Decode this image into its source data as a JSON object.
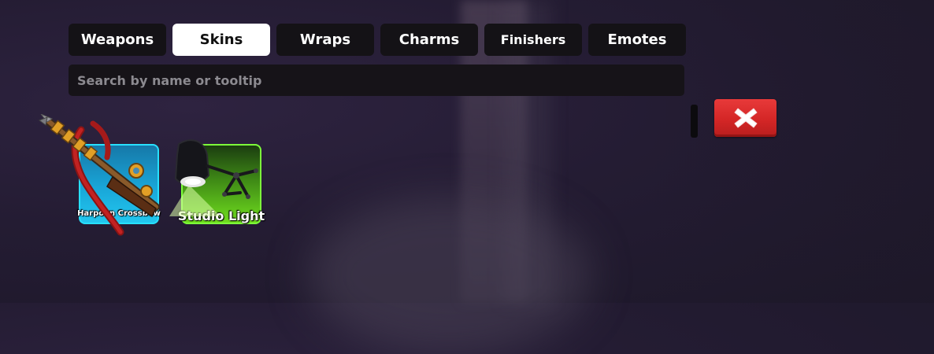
{
  "tabs": [
    {
      "label": "Weapons",
      "active": false
    },
    {
      "label": "Skins",
      "active": true
    },
    {
      "label": "Wraps",
      "active": false
    },
    {
      "label": "Charms",
      "active": false
    },
    {
      "label": "Finishers",
      "active": false
    },
    {
      "label": "Emotes",
      "active": false
    }
  ],
  "search": {
    "placeholder": "Search by name or tooltip",
    "value": ""
  },
  "close_button": {
    "icon": "close-x-icon",
    "color": "#d42626"
  },
  "items": [
    {
      "name": "Harpoon Crossbow",
      "rarity_color": "#28e0ff",
      "icon": "harpoon-crossbow-icon"
    },
    {
      "name": "Studio Light",
      "rarity_color": "#7dff3a",
      "icon": "studio-light-icon"
    }
  ]
}
